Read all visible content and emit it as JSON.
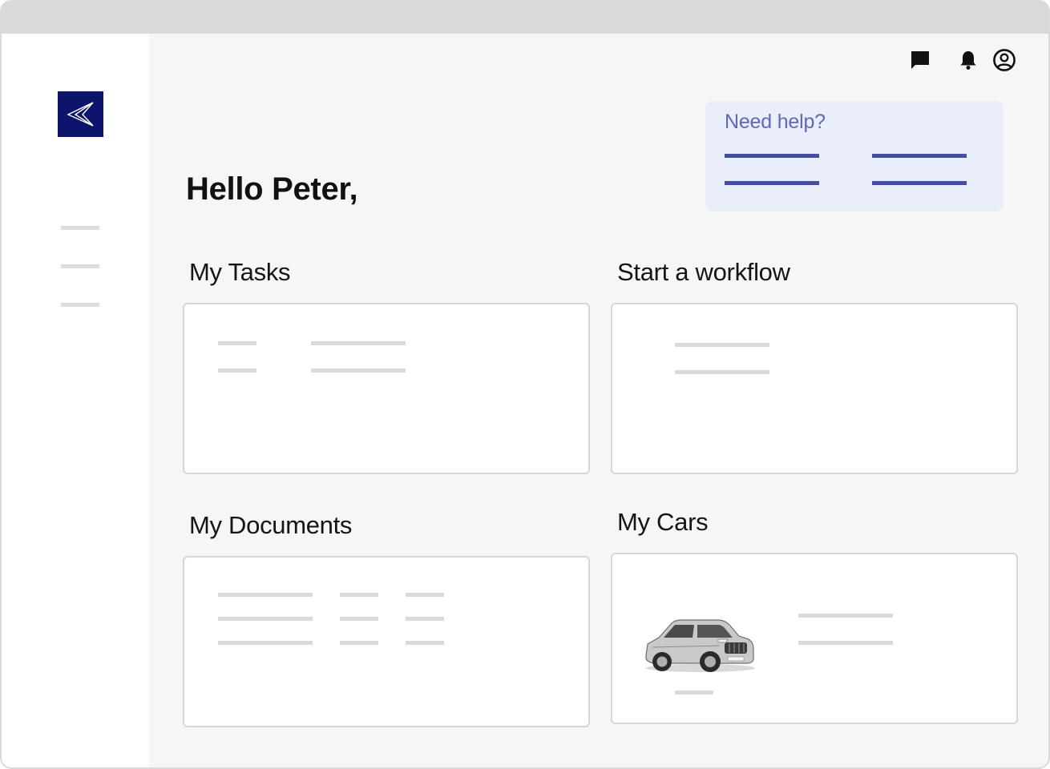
{
  "header": {
    "icons": [
      "chat-icon",
      "bell-icon",
      "account-circle-icon"
    ]
  },
  "sidebar": {
    "logo": "brand-logo",
    "brand_color": "#0e146b"
  },
  "help": {
    "title": "Need help?",
    "accent_color": "#444f9b"
  },
  "main": {
    "greeting": "Hello Peter,",
    "sections": {
      "tasks": "My Tasks",
      "workflow": "Start a workflow",
      "documents": "My Documents",
      "cars": "My Cars"
    }
  }
}
